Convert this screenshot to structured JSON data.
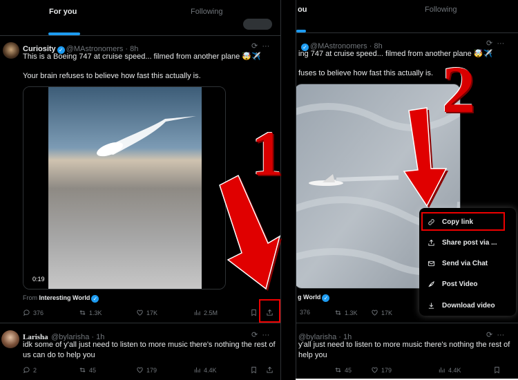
{
  "left": {
    "tabs": {
      "active": "For you",
      "inactive": "Following"
    },
    "post1": {
      "name": "Curiosity",
      "handle": "@MAstronomers · 8h",
      "line1": "This is a Boeing 747 at cruise speed... filmed from another plane 🤯✈️",
      "line2": "Your brain refuses to believe how fast this actually is.",
      "duration": "0:19",
      "from_prefix": "From",
      "from_source": "Interesting World",
      "replies": "376",
      "reposts": "1.3K",
      "likes": "17K",
      "views": "2.5M"
    },
    "post2": {
      "name": "Larisha",
      "handle": "@bylarisha · 1h",
      "line1": "idk some of y'all just need to listen to more music there's nothing the rest of",
      "line2": "us can do to help you",
      "replies": "2",
      "reposts": "45",
      "likes": "179",
      "views": "4.4K"
    },
    "annotation": "1"
  },
  "right": {
    "tabs": {
      "active": "ou",
      "inactive": "Following"
    },
    "post1": {
      "handle": "@MAstronomers · 8h",
      "line1": "ing 747 at cruise speed... filmed from another plane 🤯✈️",
      "line2": "fuses to believe how fast this actually is.",
      "from_source": "g World",
      "replies": "376",
      "reposts": "1.3K",
      "likes": "17K"
    },
    "post2": {
      "handle": "@bylarisha · 1h",
      "line1": "y'all just need to listen to more music there's nothing the rest of",
      "line2": "help you",
      "reposts": "45",
      "likes": "179",
      "views": "4.4K"
    },
    "menu": {
      "items": [
        "Copy link",
        "Share post via ...",
        "Send via Chat",
        "Post Video",
        "Download video"
      ]
    },
    "annotation": "2"
  },
  "colors": {
    "accent": "#1d9bf0",
    "annotation_red": "#d80000",
    "background": "#000000"
  }
}
